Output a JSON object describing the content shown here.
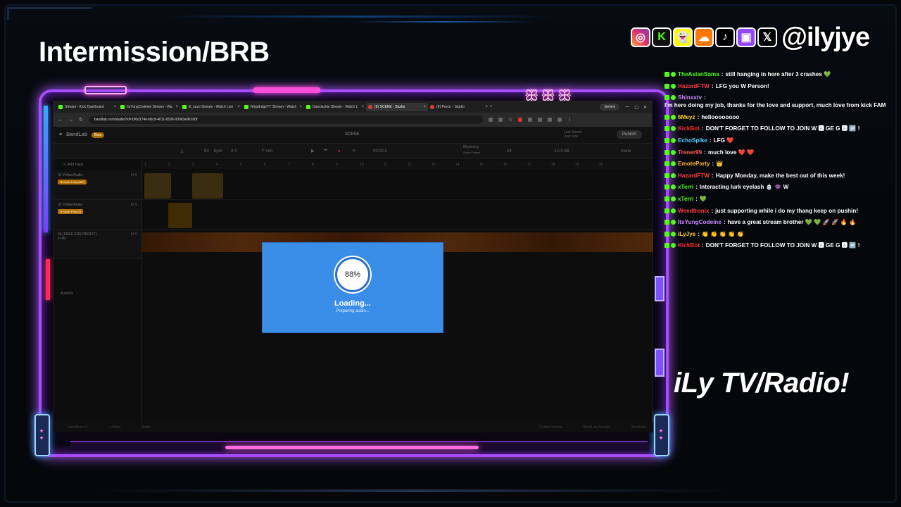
{
  "title": "Intermission/BRB",
  "socials": {
    "handle": "@ilyjye",
    "icons": [
      "instagram-icon",
      "kick-icon",
      "snapchat-icon",
      "soundcloud-icon",
      "tiktok-icon",
      "twitch-icon",
      "x-icon"
    ]
  },
  "browser": {
    "tabs": [
      {
        "label": "Stream - Kick Dashboard",
        "icon": "kick"
      },
      {
        "label": "ItsYungCodeine Stream - Wa",
        "icon": "kick"
      },
      {
        "label": "lil_savo Stream - Watch Live",
        "icon": "kick"
      },
      {
        "label": "NinjaEdgeYT Stream - Watch",
        "icon": "kick"
      },
      {
        "label": "Danslackie Stream - Watch L",
        "icon": "kick"
      },
      {
        "label": "(8) SCENE - Studio",
        "icon": "bandlab",
        "active": true
      },
      {
        "label": "(8) Press' - Studio",
        "icon": "bandlab"
      }
    ],
    "gemini_label": "Gemini",
    "url": "bandlab.com/studio?id=190d174e-b6c9-4011-8196-000d3e96100f"
  },
  "studio": {
    "logo": "BandLab",
    "beta": "Beta",
    "scene": "SCENE",
    "last_saved": "Last Saved",
    "last_saved_time": "Just now",
    "publish": "Publish",
    "invite": "Invite",
    "bpm": "93",
    "bpm_unit": "bpm",
    "time_sig": "4  4",
    "key": "F min",
    "time": "00:00.0",
    "mastering": "Mastering",
    "mastering_sub": "Select Preset",
    "zoom": "-24",
    "db": "-10.0 dB",
    "add_track": "Add Track",
    "tracks": [
      {
        "name": "01 Yellow/Audio",
        "tag": "Jf:Cadio Prds (0KP)"
      },
      {
        "name": "02 Yellow/Audio",
        "tag": "Jf Cadio Prds (0)"
      },
      {
        "name": "03 (FREE FOR PROFIT) ...",
        "tag": "In Rx"
      }
    ],
    "automix": "AutoMix",
    "ruler": [
      "1",
      "2",
      "3",
      "4",
      "5",
      "6",
      "7",
      "8",
      "9",
      "10",
      "11",
      "12",
      "13",
      "14",
      "15",
      "16",
      "17",
      "18",
      "19",
      "20"
    ],
    "footer": [
      "UsheRem #1",
      "+ Mixer",
      "Editor",
      "Collab Friends",
      "BandLab Sounds",
      "Shortcuts"
    ]
  },
  "loader": {
    "percent": "88%",
    "progress": 0.88,
    "label": "Loading...",
    "sub": "Preparing audio..."
  },
  "chat": [
    {
      "user": "TheAsianSama",
      "color": "#53fc18",
      "text": "still hanging in here after 3 crashes 💚"
    },
    {
      "user": "HazardFTW",
      "color": "#ff3d3d",
      "text": "LFG you W Person!"
    },
    {
      "user": "Shinxxtv",
      "color": "#c98bff",
      "text": "I'm here doing my job, thanks for the love and support, much love from kick FAM"
    },
    {
      "user": "6Meyz",
      "color": "#ffd12a",
      "text": "helloooooooo"
    },
    {
      "user": "KickBot",
      "color": "#ff2b2b",
      "text": "DON'T FORGET TO FOLLOW TO JOIN W 🅰 GE G 🅰 🆙 !"
    },
    {
      "user": "EchoSpike",
      "color": "#4fd1ff",
      "text": "LFG ❤️"
    },
    {
      "user": "Trener99",
      "color": "#ff5a5a",
      "text": "much love ❤️ ❤️"
    },
    {
      "user": "EmoteParty",
      "color": "#ffb02e",
      "text": "👑"
    },
    {
      "user": "HazardFTW",
      "color": "#ff3d3d",
      "text": "Happy Monday, make the best out of this week!"
    },
    {
      "user": "xTerri",
      "color": "#53fc18",
      "text": "Interacting lurk eyelash 🍵 👾 W"
    },
    {
      "user": "xTerri",
      "color": "#53fc18",
      "text": "💚"
    },
    {
      "user": "Weedtronix",
      "color": "#ff3d3d",
      "text": "just supporting while i do my thang keep on pushin!"
    },
    {
      "user": "ItsYungCodeine",
      "color": "#c98bff",
      "text": "have a great stream brother 💚 💚 🚀 🚀 🔥 🔥"
    },
    {
      "user": "iLyJye",
      "color": "#ffd12a",
      "text": "👏 👏 👏 👏 👏"
    },
    {
      "user": "KickBot",
      "color": "#ff2b2b",
      "text": "DON'T FORGET TO FOLLOW TO JOIN W 🅰 GE G 🅰 🆙 !"
    }
  ],
  "radio_title": "iLy TV/Radio!"
}
